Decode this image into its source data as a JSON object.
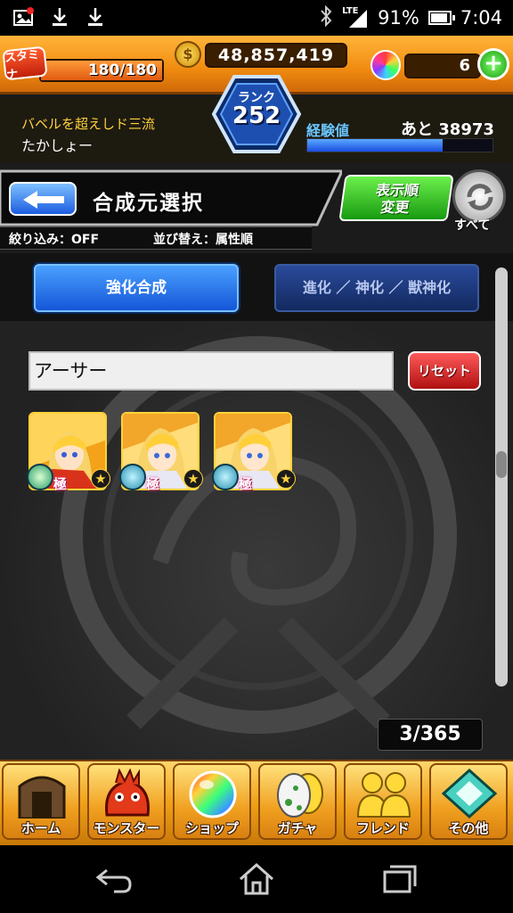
{
  "status_bar": {
    "network": "LTE",
    "battery_percent": "91%",
    "battery_level": 0.91,
    "time": "7:04",
    "icons": [
      "notification-image-icon",
      "download-icon",
      "download-icon",
      "bluetooth-icon",
      "signal-icon",
      "battery-icon"
    ]
  },
  "header": {
    "stamina_label": "スタミナ",
    "stamina": "180/180",
    "stamina_level": 1.0,
    "coins": "48,857,419",
    "orbs": "6",
    "rank_label": "ランク",
    "rank": "252",
    "player_title": "バベルを超えしド三流",
    "player_name": "たかしょー",
    "exp_label": "経験値",
    "exp_remaining": "あと 38973",
    "exp_level": 0.73
  },
  "screen": {
    "title": "合成元選択",
    "filter": "絞り込み：OFF",
    "sort": "並び替え：属性順",
    "sort_button_line1": "表示順",
    "sort_button_line2": "変更",
    "all_label": "すべて"
  },
  "tabs": [
    {
      "label": "強化合成",
      "active": true
    },
    {
      "label": "進化 ／ 神化 ／ 獣神化",
      "active": false
    }
  ],
  "search": {
    "value": "アーサー",
    "reset_label": "リセット"
  },
  "monsters": [
    {
      "name": "arthur-1",
      "rarity": "極",
      "element": "wood"
    },
    {
      "name": "arthur-2",
      "rarity": "極",
      "element": "water"
    },
    {
      "name": "arthur-3",
      "rarity": "極",
      "element": "water"
    }
  ],
  "count": "3/365",
  "bottom_nav": [
    {
      "label": "ホーム",
      "icon": "home-gate-icon"
    },
    {
      "label": "モンスター",
      "icon": "monster-dragon-icon"
    },
    {
      "label": "ショップ",
      "icon": "rainbow-orb-icon"
    },
    {
      "label": "ガチャ",
      "icon": "egg-icon"
    },
    {
      "label": "フレンド",
      "icon": "friends-icon"
    },
    {
      "label": "その他",
      "icon": "other-menu-icon"
    }
  ],
  "colors": {
    "header_orange": "#f08b10",
    "accent_blue": "#1456d8",
    "reset_red": "#b01010",
    "sort_green": "#189a10"
  }
}
